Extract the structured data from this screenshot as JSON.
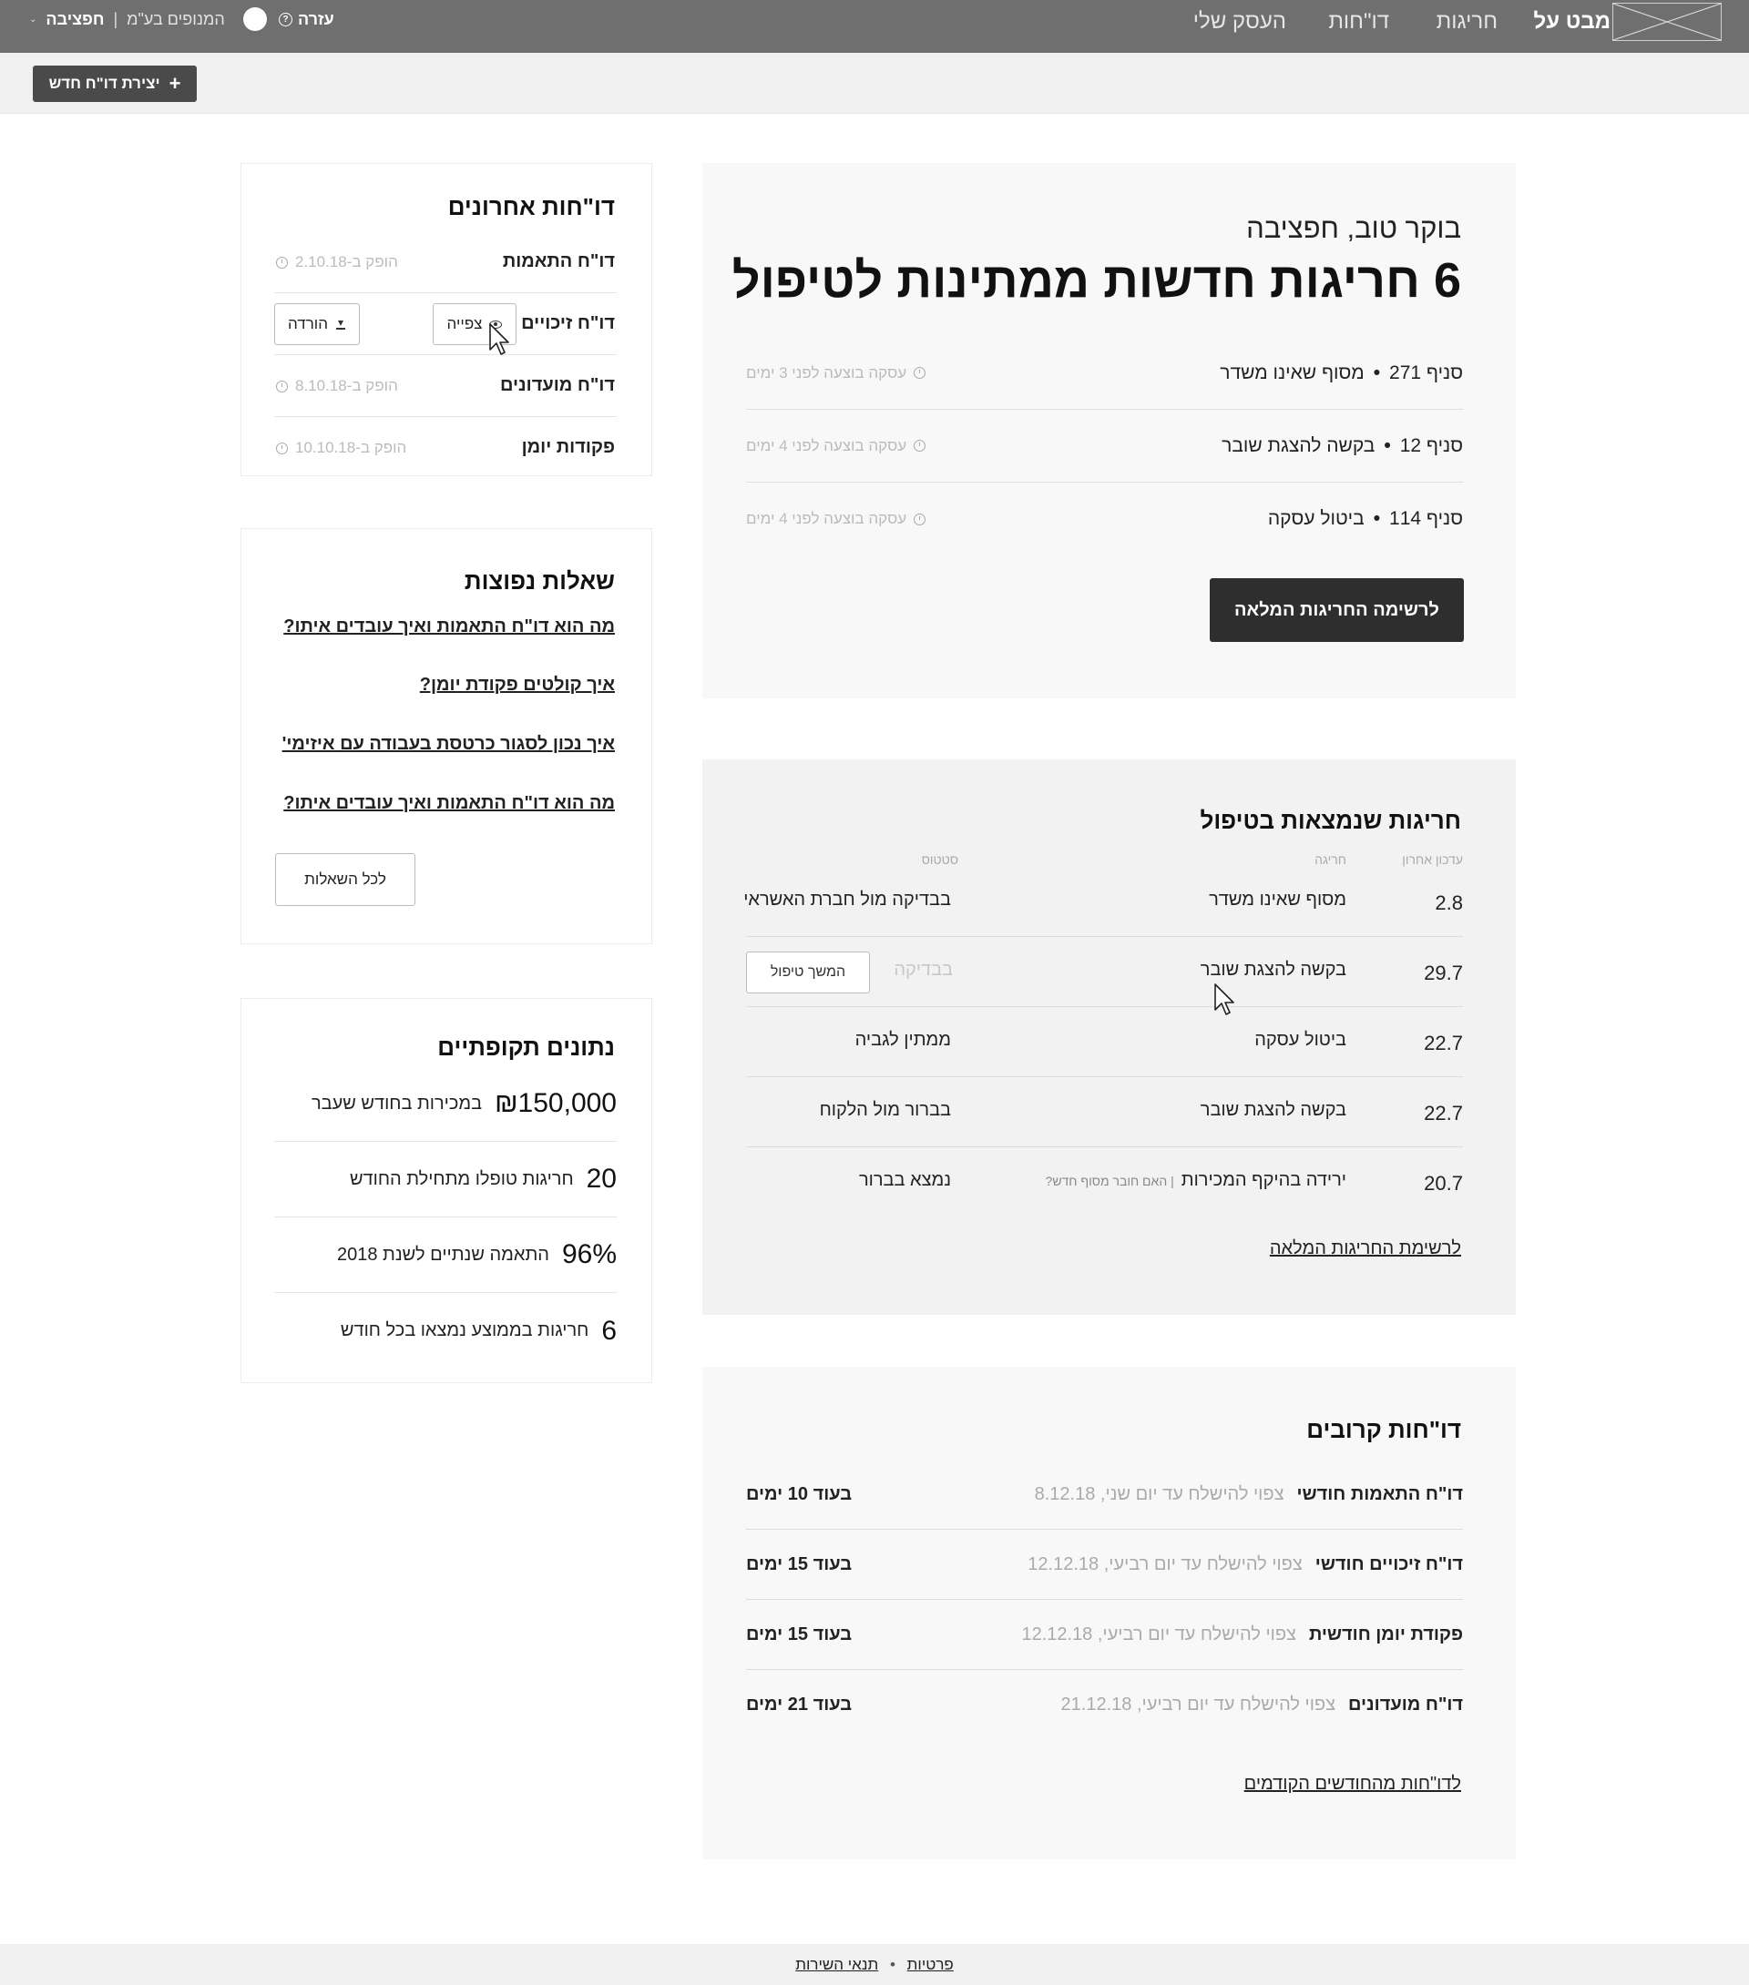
{
  "nav": {
    "items": [
      {
        "label": "מבט על",
        "active": true
      },
      {
        "label": "חריגות",
        "active": false
      },
      {
        "label": "דו\"חות",
        "active": false
      },
      {
        "label": "העסק שלי",
        "active": false
      }
    ],
    "help": "עזרה",
    "help_icon": "?",
    "account_name": "חפציבה",
    "account_company": "המנופים בע\"מ",
    "account_separator": "|"
  },
  "toolbar": {
    "new_report_label": "יצירת דו\"ח חדש",
    "new_report_icon": "+"
  },
  "welcome": {
    "greeting": "בוקר טוב, חפציבה",
    "headline": "6 חריגות חדשות ממתינות לטיפול",
    "items": [
      {
        "branch": "סניף 271",
        "desc": "מסוף שאינו משדר",
        "meta": "עסקה בוצעה לפני 3 ימים"
      },
      {
        "branch": "סניף 12",
        "desc": "בקשה להצגת שובר",
        "meta": "עסקה בוצעה לפני 4 ימים"
      },
      {
        "branch": "סניף 114",
        "desc": "ביטול עסקה",
        "meta": "עסקה בוצעה לפני 4 ימים"
      }
    ],
    "dot": "•",
    "cta": "לרשימה החריגות המלאה"
  },
  "handling": {
    "title": "חריגות שנמצאות בטיפול",
    "col_date": "עדכון אחרון",
    "col_issue": "חריגה",
    "col_status": "סטטוס",
    "rows": [
      {
        "date": "2.8",
        "issue": "מסוף שאינו משדר",
        "status": "בבדיקה מול חברת האשראי"
      },
      {
        "date": "29.7",
        "issue": "בקשה להצגת שובר",
        "status": "בבדיקה",
        "action": "המשך טיפול"
      },
      {
        "date": "22.7",
        "issue": "ביטול עסקה",
        "status": "ממתין לגביה"
      },
      {
        "date": "22.7",
        "issue": "בקשה להצגת שובר",
        "status": "בברור מול הלקוח"
      },
      {
        "date": "20.7",
        "issue": "ירידה בהיקף המכירות",
        "issue_sub": "| האם חובר מסוף חדש?",
        "status": "נמצא בברור"
      }
    ],
    "all_link": "לרשימת החריגות המלאה"
  },
  "upcoming": {
    "title": "דו\"חות קרובים",
    "rows": [
      {
        "name": "דו\"ח התאמות חודשי",
        "note": "צפוי להישלח עד יום שני, 8.12.18",
        "due": "בעוד 10 ימים"
      },
      {
        "name": "דו\"ח זיכויים חודשי",
        "note": "צפוי להישלח עד יום רביעי, 12.12.18",
        "due": "בעוד 15 ימים"
      },
      {
        "name": "פקודת יומן חודשית",
        "note": "צפוי להישלח עד יום רביעי, 12.12.18",
        "due": "בעוד 15 ימים"
      },
      {
        "name": "דו\"ח מועדונים",
        "note": "צפוי להישלח עד יום רביעי, 21.12.18",
        "due": "בעוד 21 ימים"
      }
    ],
    "prev_link": "לדו\"חות מהחודשים הקודמים"
  },
  "recent": {
    "title": "דו\"חות אחרונים",
    "rows": [
      {
        "name": "דו\"ח התאמות",
        "meta": "הופק ב-2.10.18"
      },
      {
        "name": "דו\"ח זיכויים",
        "view": "צפייה",
        "download": "הורדה"
      },
      {
        "name": "דו\"ח מועדונים",
        "meta": "הופק ב-8.10.18"
      },
      {
        "name": "פקודות יומן",
        "meta": "הופק ב-10.10.18"
      }
    ]
  },
  "faq": {
    "title": "שאלות נפוצות",
    "items": [
      "מה הוא דו\"ח התאמות ואיך עובדים איתו?",
      "איך קולטים פקודת יומן?",
      "איך נכון לסגור כרטסת בעבודה עם איזימי'",
      "מה הוא דו\"ח התאמות ואיך עובדים איתו?"
    ],
    "all_label": "לכל השאלות"
  },
  "stats": {
    "title": "נתונים תקופתיים",
    "rows": [
      {
        "value": "₪150,000",
        "label": "במכירות בחודש שעבר"
      },
      {
        "value": "20",
        "label": "חריגות טופלו מתחילת החודש"
      },
      {
        "value": "96%",
        "label": "התאמה שנתיים לשנת 2018"
      },
      {
        "value": "6",
        "label": "חריגות בממוצע נמצאו בכל חודש"
      }
    ]
  },
  "footer": {
    "privacy": "פרטיות",
    "terms": "תנאי השירות",
    "sep": "•"
  }
}
